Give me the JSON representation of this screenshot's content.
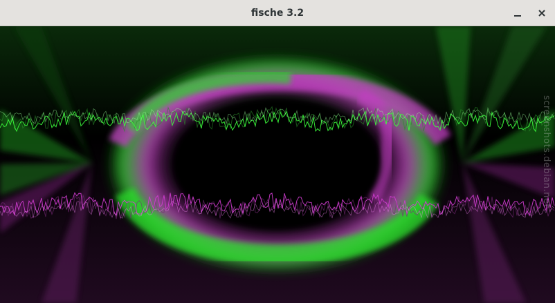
{
  "window": {
    "title": "fische 3.2",
    "minimize_glyph": "–",
    "close_glyph": "✕"
  },
  "visualization": {
    "description_colors": {
      "background": "#000000",
      "green": "#3cff3c",
      "magenta": "#d23cd2"
    }
  },
  "watermark": {
    "text": "screenshots.debian.net"
  }
}
